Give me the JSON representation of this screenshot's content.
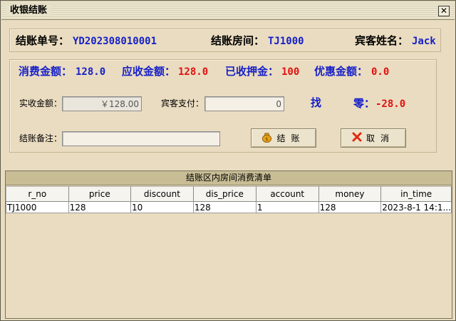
{
  "window": {
    "title": "收银结账"
  },
  "header": {
    "bill_no_label": "结账单号：",
    "bill_no": "YD202308010001",
    "room_label": "结账房间：",
    "room": "TJ1000",
    "guest_label": "宾客姓名：",
    "guest": "Jack"
  },
  "summary": {
    "consume_label": "消费金额：",
    "consume": "128.0",
    "receivable_label": "应收金额：",
    "receivable": "128.0",
    "deposit_label": "已收押金：",
    "deposit": "100",
    "discount_label": "优惠金额：",
    "discount": "0.0"
  },
  "form": {
    "actual_label": "实收金额：",
    "actual_value": "￥128.00",
    "guest_pay_label": "宾客支付：",
    "guest_pay_value": "0",
    "change_label_1": "找",
    "change_label_2": "零：",
    "change_value": "-28.0",
    "remark_label": "结账备注：",
    "remark_value": ""
  },
  "buttons": {
    "checkout": "结账",
    "cancel": "取消"
  },
  "table": {
    "caption": "结账区内房间消费清单",
    "columns": [
      "r_no",
      "price",
      "discount",
      "dis_price",
      "account",
      "money",
      "in_time"
    ],
    "rows": [
      [
        "TJ1000",
        "128",
        "10",
        "128",
        "1",
        "128",
        "2023-8-1 14:1..."
      ]
    ]
  },
  "colors": {
    "blue": "#1620c8",
    "red": "#e01010",
    "background": "#e9dcc0"
  }
}
